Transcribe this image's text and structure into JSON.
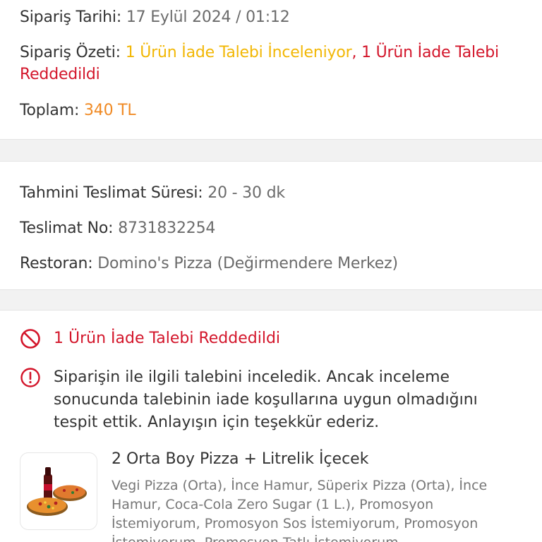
{
  "order": {
    "date_label": "Sipariş Tarihi:",
    "date_value": "17 Eylül 2024 / 01:12",
    "summary_label": "Sipariş Özeti:",
    "summary_part1": "1 Ürün İade Talebi İnceleniyor",
    "summary_sep": ",",
    "summary_part2": "1 Ürün İade Talebi Reddedildi",
    "total_label": "Toplam:",
    "total_value": "340 TL"
  },
  "delivery": {
    "eta_label": "Tahmini Teslimat Süresi:",
    "eta_value": "20 - 30 dk",
    "no_label": "Teslimat No:",
    "no_value": "8731832254",
    "restaurant_label": "Restoran:",
    "restaurant_value": "Domino's Pizza (Değirmendere Merkez)"
  },
  "refund": {
    "status_title": "1 Ürün İade Talebi Reddedildi",
    "info_text": "Siparişin ile ilgili talebini inceledik. Ancak inceleme sonucunda talebinin iade koşullarına uygun olmadığını tespit ettik. Anlayışın için teşekkür ederiz.",
    "product_title": "2 Orta Boy Pizza + Litrelik İçecek",
    "product_desc": "Vegi Pizza (Orta), İnce Hamur, Süperix Pizza (Orta), İnce Hamur, Coca-Cola Zero Sugar (1 L.), Promosyon İstemiyorum, Promosyon Sos İstemiyorum, Promosyon İstemiyorum, Promosyon Tatlı İstemiyorum"
  },
  "colors": {
    "pending": "#f2b705",
    "rejected": "#d3152a",
    "total": "#f08a24"
  },
  "icons": {
    "status": "forbidden-icon",
    "info": "info-icon"
  }
}
